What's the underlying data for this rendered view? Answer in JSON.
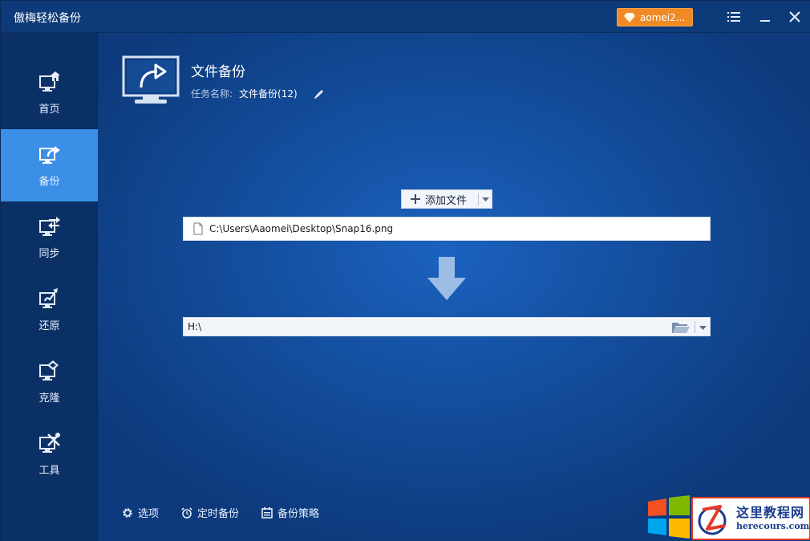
{
  "window": {
    "title": "傲梅轻松备份"
  },
  "titlebar": {
    "account_label": "aomei2...",
    "icons": [
      "diamond-icon",
      "menu-icon",
      "minimize-icon",
      "close-icon"
    ]
  },
  "sidebar": {
    "items": [
      {
        "label": "首页",
        "icon": "home-monitor-icon",
        "active": false
      },
      {
        "label": "备份",
        "icon": "backup-monitor-icon",
        "active": true
      },
      {
        "label": "同步",
        "icon": "sync-monitor-icon",
        "active": false
      },
      {
        "label": "还原",
        "icon": "restore-monitor-icon",
        "active": false
      },
      {
        "label": "克隆",
        "icon": "clone-monitor-icon",
        "active": false
      },
      {
        "label": "工具",
        "icon": "tools-monitor-icon",
        "active": false
      }
    ]
  },
  "main": {
    "title": "文件备份",
    "task_label": "任务名称:",
    "task_name": "文件备份(12)",
    "add_file_label": "添加文件",
    "source_path": "C:\\Users\\Aaomei\\Desktop\\Snap16.png",
    "destination_path": "H:\\"
  },
  "bottom": {
    "options_label": "选项",
    "schedule_label": "定时备份",
    "scheme_label": "备份策略"
  },
  "watermark": {
    "site_name": "这里教程网",
    "site_url": "herecours.com"
  },
  "colors": {
    "accent": "#3b8fe6",
    "account_button": "#f08a24",
    "background": "#0c3570"
  }
}
